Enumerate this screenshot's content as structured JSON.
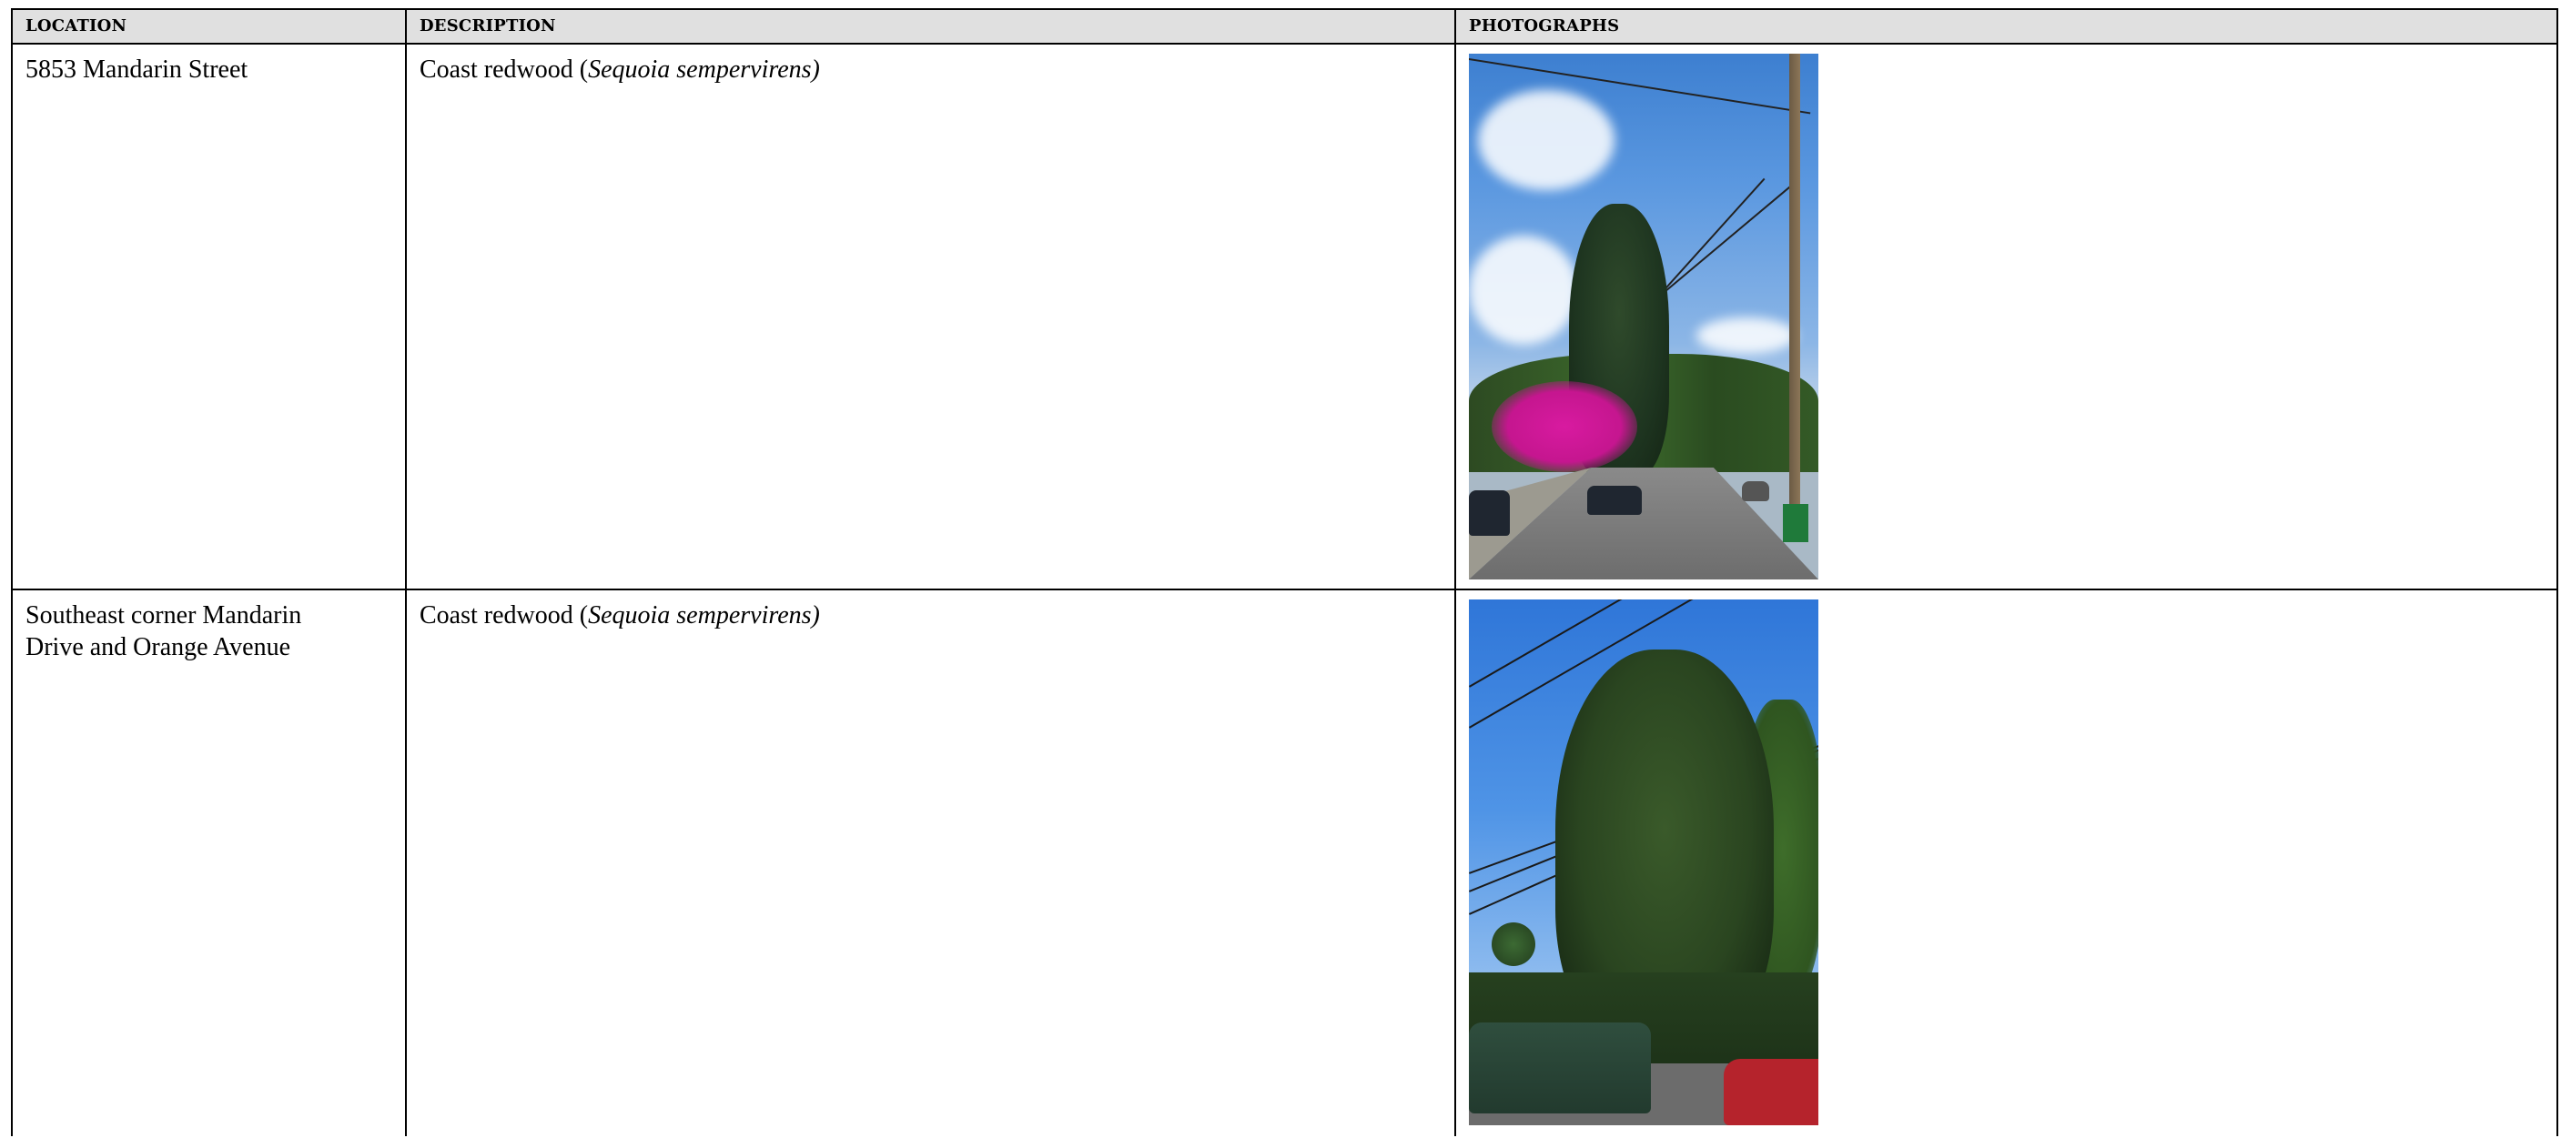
{
  "header": {
    "location": "LOCATION",
    "description": "DESCRIPTION",
    "photographs": "PHOTOGRAPHS"
  },
  "rows": [
    {
      "location": "5853 Mandarin Street",
      "description_prefix": "Coast redwood (",
      "species": "Sequoia sempervirens)",
      "photo_icon": "redwood-street-photo"
    },
    {
      "location_line1": "Southeast corner Mandarin",
      "location_line2": "Drive and Orange Avenue",
      "description_prefix": "Coast redwood (",
      "species": "Sequoia sempervirens)",
      "photo_icon": "redwood-corner-photo"
    }
  ]
}
